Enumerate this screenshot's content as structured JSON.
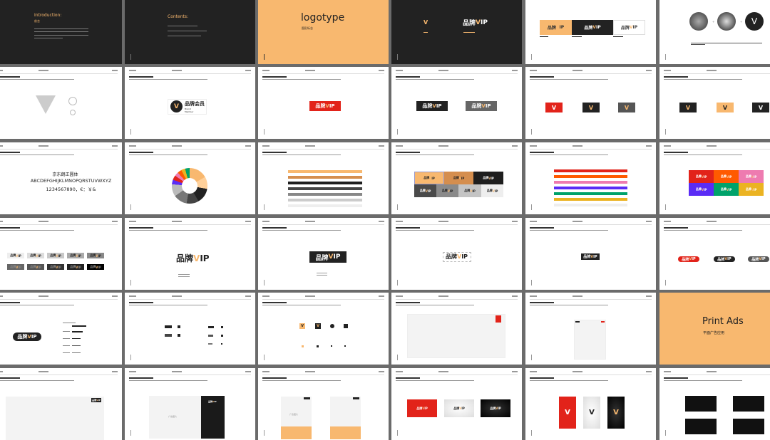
{
  "brand": {
    "cn": "品牌",
    "v": "V",
    "ip": "IP",
    "mark": "V",
    "member_cn": "品牌会员",
    "member_en1": "Brand",
    "member_en2": "Member"
  },
  "intro": {
    "title": "Introduction:",
    "subtitle": "前言"
  },
  "contents": {
    "title": "Contents:"
  },
  "logotype": {
    "title": "logotype",
    "subtitle": "图形标志"
  },
  "font": {
    "name": "京东朗正圆体",
    "alphabet": "ABCDEFGHIJKLMNOPQRSTUVWXYZ",
    "digits": "1234567890，€：￥&"
  },
  "print": {
    "title": "Print Ads",
    "subtitle": "平面广告应用",
    "ad_placeholder": "广告图片"
  },
  "colors": {
    "orange": "#f8b86f",
    "dark": "#222222",
    "red": "#e2231a",
    "vivid_orange": "#ff5a00",
    "pink": "#ee7bb0",
    "purple": "#5a2cf5",
    "green": "#00a26a",
    "yellow": "#ebb322"
  }
}
